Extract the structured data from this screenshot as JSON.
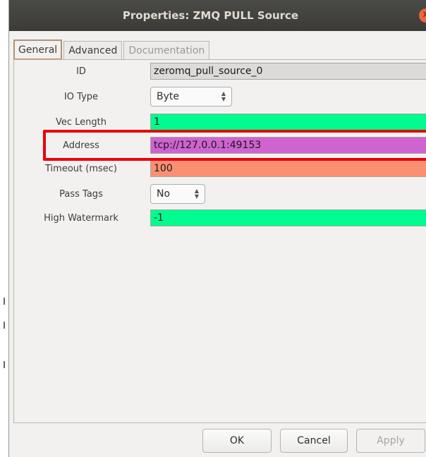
{
  "window": {
    "title": "Properties: ZMQ PULL Source"
  },
  "tabs": [
    {
      "label": "General",
      "active": true
    },
    {
      "label": "Advanced",
      "active": false
    },
    {
      "label": "Documentation",
      "active": false,
      "disabled": true
    }
  ],
  "properties": {
    "id": {
      "label": "ID",
      "value": "zeromq_pull_source_0"
    },
    "io_type": {
      "label": "IO Type",
      "value": "Byte"
    },
    "vec_length": {
      "label": "Vec Length",
      "value": "1"
    },
    "address": {
      "label": "Address",
      "value": "tcp://127.0.0.1:49153"
    },
    "timeout": {
      "label": "Timeout (msec)",
      "value": "100"
    },
    "pass_tags": {
      "label": "Pass Tags",
      "value": "No"
    },
    "high_watermark": {
      "label": "High Watermark",
      "value": "-1"
    }
  },
  "buttons": {
    "ok": "OK",
    "cancel": "Cancel",
    "apply": "Apply"
  },
  "colors": {
    "green_field": "#00fb8e",
    "magenta_field": "#cf63cf",
    "salmon_field": "#f99074",
    "highlight_box": "#e8000b"
  }
}
